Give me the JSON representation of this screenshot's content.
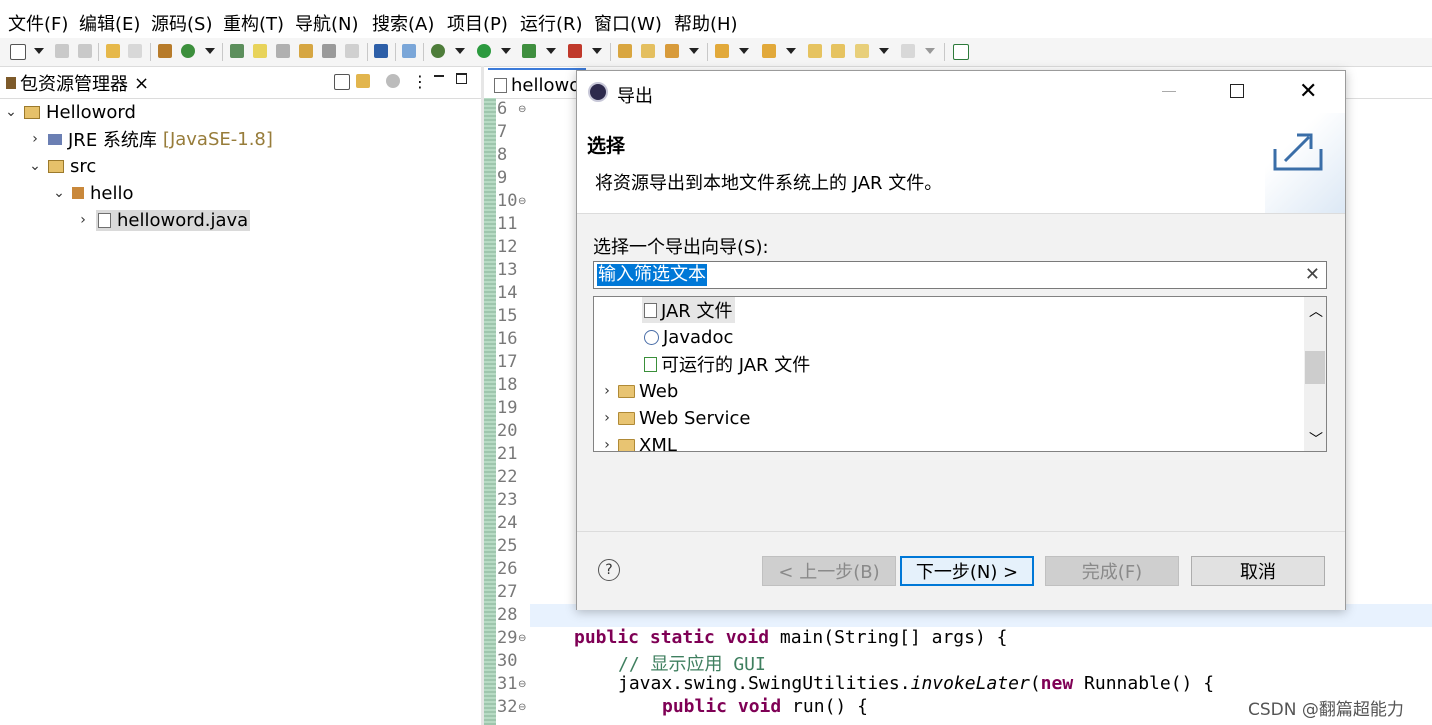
{
  "menu": [
    "文件(F)",
    "编辑(E)",
    "源码(S)",
    "重构(T)",
    "导航(N)",
    "搜索(A)",
    "项目(P)",
    "运行(R)",
    "窗口(W)",
    "帮助(H)"
  ],
  "package_explorer": {
    "tab_label": "包资源管理器",
    "close_glyph": "×",
    "tree": [
      {
        "label": "Helloword",
        "level": 0,
        "expanded": true
      },
      {
        "label": "JRE 系统库",
        "suffix": "[JavaSE-1.8]",
        "level": 1,
        "expanded": false
      },
      {
        "label": "src",
        "level": 1,
        "expanded": true
      },
      {
        "label": "hello",
        "level": 2,
        "expanded": true
      },
      {
        "label": "helloword.java",
        "level": 3,
        "expanded": false,
        "selected": true
      }
    ]
  },
  "editor": {
    "tab_label": "hellowo",
    "line_numbers": [
      "6",
      "7",
      "8",
      "9",
      "10",
      "11",
      "12",
      "13",
      "14",
      "15",
      "16",
      "17",
      "18",
      "19",
      "20",
      "21",
      "22",
      "23",
      "24",
      "25",
      "26",
      "27",
      "28",
      "29",
      "30",
      "31",
      "32"
    ],
    "code": {
      "l29_kw": "public static void",
      "l29_rest": " main(String[] args) {",
      "l30": "// 显示应用 GUI",
      "l31_a": "javax.swing.SwingUtilities.",
      "l31_b": "invokeLater",
      "l31_c": "(",
      "l31_kw": "new",
      "l31_d": " Runnable() {",
      "l32_kw": "public void",
      "l32_rest": " run() {"
    }
  },
  "dialog": {
    "title": "导出",
    "header_title": "选择",
    "header_desc": "将资源导出到本地文件系统上的 JAR 文件。",
    "wizard_label": "选择一个导出向导(S):",
    "filter_value": "输入筛选文本",
    "clear_glyph": "✕",
    "list": [
      {
        "label": "JAR 文件",
        "type": "jar",
        "selected": true
      },
      {
        "label": "Javadoc",
        "type": "javadoc"
      },
      {
        "label": "可运行的 JAR 文件",
        "type": "runnable-jar"
      },
      {
        "label": "Web",
        "type": "folder"
      },
      {
        "label": "Web Service",
        "type": "folder"
      },
      {
        "label": "XML",
        "type": "folder"
      }
    ],
    "help_glyph": "?",
    "buttons": {
      "back": "< 上一步(B)",
      "next": "下一步(N) >",
      "finish": "完成(F)",
      "cancel": "取消"
    }
  },
  "watermark": "CSDN @翻篇超能力",
  "colors": {
    "selection": "#0078d7",
    "keyword": "#7f0055",
    "comment": "#3f7f5f",
    "ruler": "#a9cfb8"
  }
}
